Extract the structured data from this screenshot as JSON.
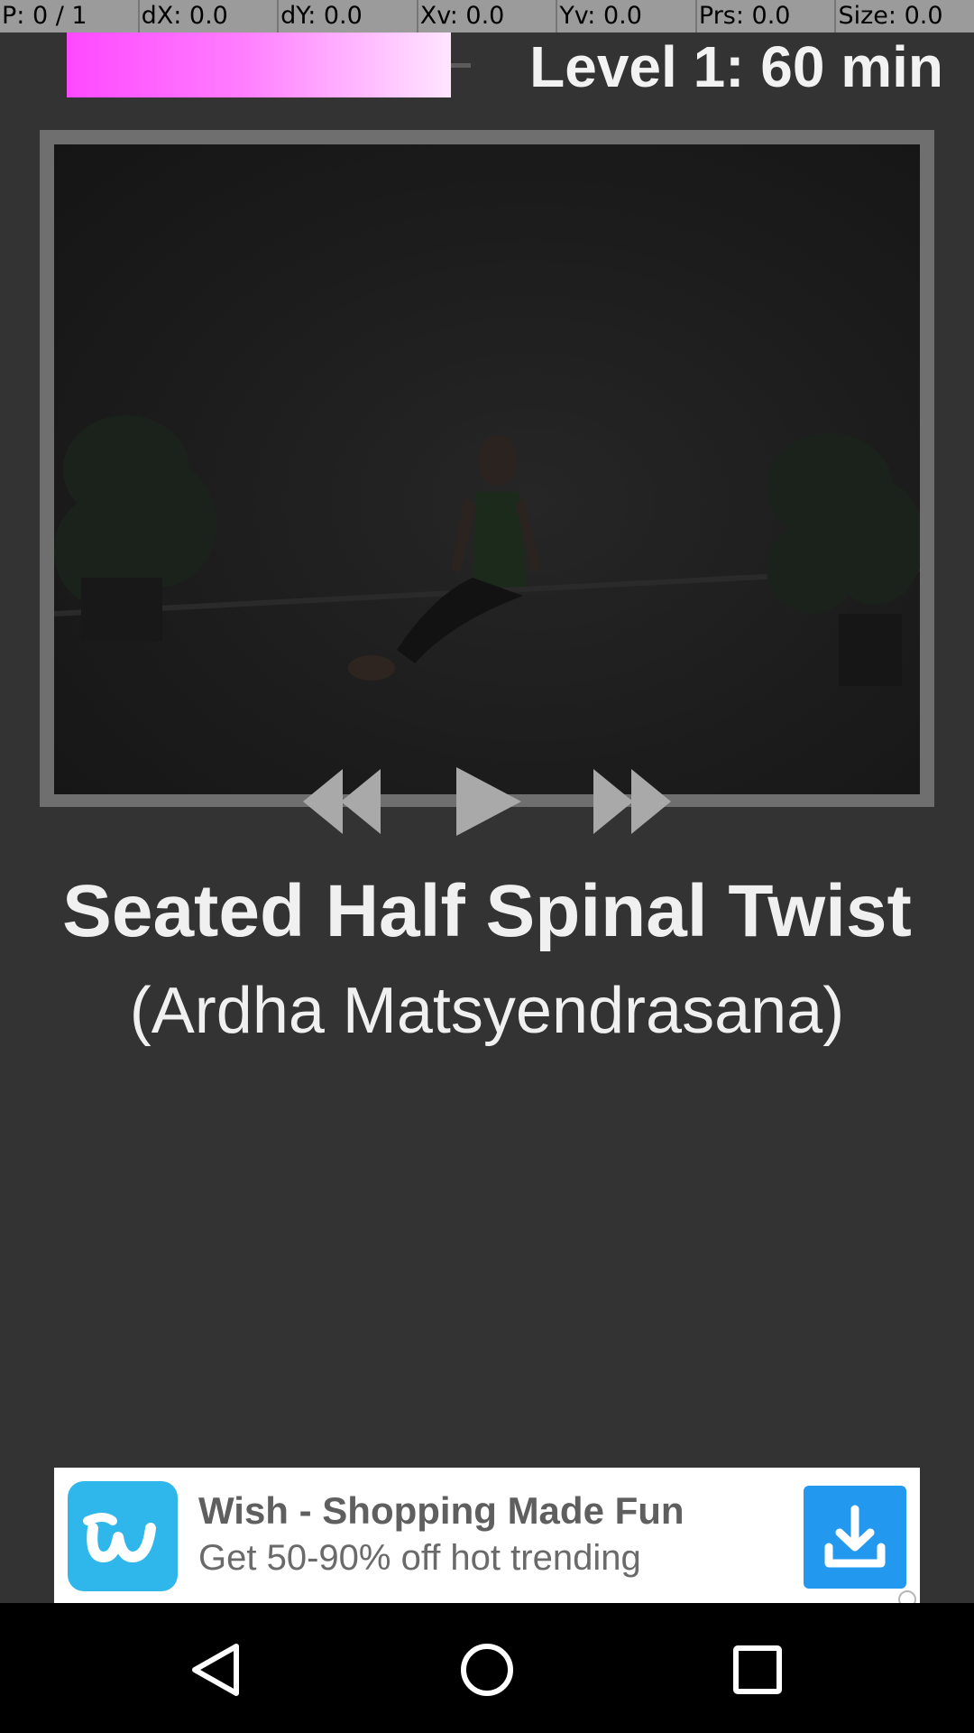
{
  "debug_bar": {
    "pointer": "P: 0 / 1",
    "dx": "dX: 0.0",
    "dy": "dY: 0.0",
    "xv": "Xv: 0.0",
    "yv": "Yv: 0.0",
    "prs": "Prs: 0.0",
    "size": "Size: 0.0"
  },
  "header": {
    "level_label": "Level 1: 60 min",
    "progress_fraction": 0.0,
    "progress_colors": [
      "#ff49ff",
      "#ffe6ff"
    ]
  },
  "video": {
    "controls": {
      "rewind_icon": "rewind-icon",
      "play_icon": "play-icon",
      "forward_icon": "fast-forward-icon"
    }
  },
  "pose": {
    "name": "Seated Half Spinal Twist",
    "sanskrit": "(Ardha Matsyendrasana)"
  },
  "ad": {
    "title": "Wish - Shopping Made Fun",
    "subtitle": "Get 50-90% off hot trending",
    "logo_icon": "wish-logo-icon",
    "download_icon": "download-icon",
    "accent_color": "#2fb7ec",
    "button_color": "#2299ef"
  },
  "nav_bar": {
    "back_icon": "back-triangle-icon",
    "home_icon": "home-circle-icon",
    "recent_icon": "recent-apps-square-icon"
  }
}
